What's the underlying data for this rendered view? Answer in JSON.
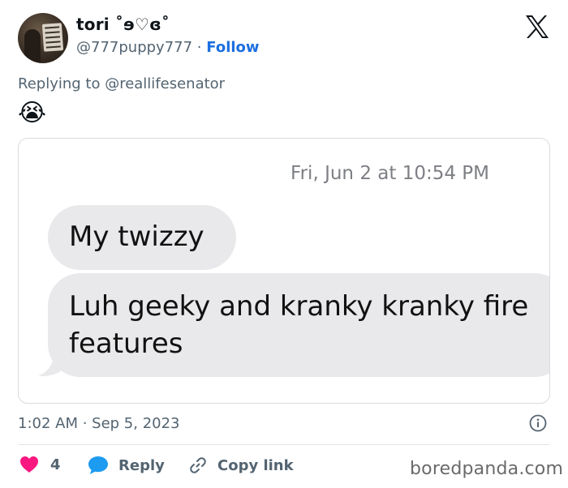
{
  "tweet": {
    "author": {
      "display_name": "tori ˚ɘ♡ɞ˚",
      "handle": "@777puppy777",
      "separator": "·",
      "follow_label": "Follow"
    },
    "replying_to": "Replying to @reallifesenator",
    "body_emoji": "😭",
    "embedded_screenshot": {
      "date_header": "Fri, Jun 2 at 10:54 PM",
      "messages": [
        "My twizzy",
        "Luh geeky and kranky kranky fire features"
      ]
    },
    "timestamp": "1:02 AM · Sep 5, 2023",
    "actions": {
      "like_count": "4",
      "reply_label": "Reply",
      "copy_link_label": "Copy link"
    }
  },
  "watermark": "boredpanda.com",
  "icons": {
    "logo": "x-logo-icon",
    "info": "info-icon",
    "like": "heart-icon",
    "reply": "speech-bubble-icon",
    "copy": "link-icon"
  },
  "colors": {
    "follow": "#1d6fe0",
    "heart": "#f91880",
    "reply_bubble": "#1d9bf0",
    "bubble_gray": "#e9e9eb",
    "secondary_text": "#536471"
  }
}
